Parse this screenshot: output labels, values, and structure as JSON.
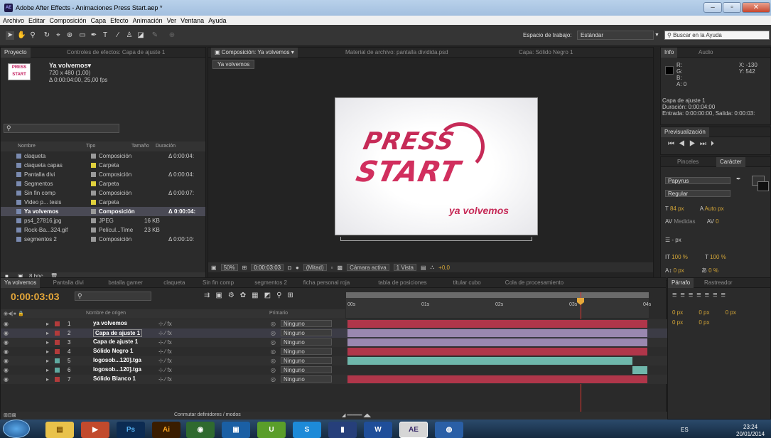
{
  "window": {
    "title": "Adobe After Effects - Animaciones Press Start.aep *",
    "app_badge": "AE"
  },
  "menu": [
    "Archivo",
    "Editar",
    "Composición",
    "Capa",
    "Efecto",
    "Animación",
    "Ver",
    "Ventana",
    "Ayuda"
  ],
  "toolbar": {
    "workspace_label": "Espacio de trabajo:",
    "workspace_value": "Estándar",
    "help_placeholder": "Buscar en la Ayuda"
  },
  "project": {
    "tab1": "Proyecto",
    "tab2": "Controles de efectos: Capa de ajuste 1",
    "selected_name": "Ya volvemos▾",
    "selected_size": "720 x 480 (1,00)",
    "selected_dur": "Δ 0:00:04:00, 25,00 fps",
    "columns": [
      "Nombre",
      "Tipo",
      "Tamaño",
      "Duración"
    ],
    "items": [
      {
        "name": "claqueta",
        "type": "Composición",
        "size": "",
        "dur": "Δ 0:00:04:",
        "color": "#9a9a9a"
      },
      {
        "name": "claqueta capas",
        "type": "Carpeta",
        "size": "",
        "dur": "",
        "color": "#e0d03c"
      },
      {
        "name": "Pantalla divi",
        "type": "Composición",
        "size": "",
        "dur": "Δ 0:00:04:",
        "color": "#9a9a9a"
      },
      {
        "name": "Segmentos",
        "type": "Carpeta",
        "size": "",
        "dur": "",
        "color": "#e0d03c"
      },
      {
        "name": "Sin fin comp",
        "type": "Composición",
        "size": "",
        "dur": "Δ 0:00:07:",
        "color": "#9a9a9a"
      },
      {
        "name": "Video p... tesis",
        "type": "Carpeta",
        "size": "",
        "dur": "",
        "color": "#e0d03c"
      },
      {
        "name": "Ya volvemos",
        "type": "Composición",
        "size": "",
        "dur": "Δ 0:00:04:",
        "color": "#9a9a9a"
      },
      {
        "name": "ps4_27816.jpg",
        "type": "JPEG",
        "size": "16 KB",
        "dur": "",
        "color": "#9a9a9a"
      },
      {
        "name": "Rock-Ba...324.gif",
        "type": "Películ...Time",
        "size": "23 KB",
        "dur": "",
        "color": "#9a9a9a"
      },
      {
        "name": "segmentos 2",
        "type": "Composición",
        "size": "",
        "dur": "Δ 0:00:10:",
        "color": "#9a9a9a"
      }
    ],
    "bpc": "8 bpc"
  },
  "comp": {
    "tab": "Composición: Ya volvemos",
    "tab2": "Material de archivo: pantalla dividida.psd",
    "tab3": "Capa: Sólido Negro 1",
    "breadcrumb": "Ya volvemos",
    "logo_line1": "PRESS",
    "logo_line2": "START",
    "logo_tag": "ya volvemos",
    "zoom": "50%",
    "timecode": "0:00:03:03",
    "resolution": "(Mitad)",
    "camera": "Cámara activa",
    "views": "1 Vista",
    "exposure": "+0,0"
  },
  "info": {
    "tab1": "Info",
    "tab2": "Audio",
    "r": "R:",
    "g": "G:",
    "b": "B:",
    "a": "A:  0",
    "x": "X: -130",
    "y": "Y:  542",
    "layer": "Capa de ajuste 1",
    "duration": "Duración: 0:00:04:00",
    "entrada": "Entrada: 0:00:00:00, Salida: 0:00:03:"
  },
  "preview": {
    "tab": "Previsualización"
  },
  "character": {
    "tab1": "Pinceles",
    "tab2": "Carácter",
    "font": "Papyrus",
    "style": "Regular",
    "size": "84 px",
    "leading": "Auto px",
    "kerning": "Medidas",
    "tracking": "0",
    "indent": "- px",
    "vscale": "100 %",
    "hscale": "100 %",
    "baseline": "0 px",
    "tsume": "0 %"
  },
  "paragraph": {
    "tab1": "Párrafo",
    "tab2": "Rastreador",
    "v1": "0 px",
    "v2": "0 px",
    "v3": "0 px",
    "v4": "0 px",
    "v5": "0 px"
  },
  "timeline": {
    "tabs": [
      "Ya volvemos",
      "Pantalla divi",
      "batalla gamer",
      "claqueta",
      "Sin fin comp",
      "segmentos 2",
      "ficha personal roja",
      "tabla de posiciones",
      "titular cubo",
      "Cola de procesamiento"
    ],
    "timecode": "0:00:03:03",
    "col_source": "Nombre de origen",
    "col_parent": "Primario",
    "ruler": [
      "00s",
      "01s",
      "02s",
      "03s",
      "04s"
    ],
    "layers": [
      {
        "num": "1",
        "name": "ya volvemos",
        "label": "#b23b3b",
        "parent": "Ninguno",
        "bar": "#b0364a",
        "start": 0,
        "end": 1
      },
      {
        "num": "2",
        "name": "Capa de ajuste 1",
        "label": "#b23b3b",
        "parent": "Ninguno",
        "bar": "#9a88b0",
        "start": 0,
        "end": 1
      },
      {
        "num": "3",
        "name": "Capa de ajuste 1",
        "label": "#b23b3b",
        "parent": "Ninguno",
        "bar": "#9a88b0",
        "start": 0,
        "end": 1
      },
      {
        "num": "4",
        "name": "Sólido Negro 1",
        "label": "#b23b3b",
        "parent": "Ninguno",
        "bar": "#b0364a",
        "start": 0,
        "end": 1
      },
      {
        "num": "5",
        "name": "logosob...120].tga",
        "label": "#5fa9a0",
        "parent": "Ninguno",
        "bar": "#6fb7ab",
        "start": 0,
        "end": 0.95
      },
      {
        "num": "6",
        "name": "logosob...120].tga",
        "label": "#5fa9a0",
        "parent": "Ninguno",
        "bar": "#6fb7ab",
        "start": 0.95,
        "end": 1
      },
      {
        "num": "7",
        "name": "Sólido Blanco 1",
        "label": "#b23b3b",
        "parent": "Ninguno",
        "bar": "#b0364a",
        "start": 0,
        "end": 1
      }
    ],
    "toggle_label": "Conmutar definidores / modos"
  },
  "taskbar": {
    "lang": "ES",
    "time": "23:24",
    "date": "20/01/2014"
  }
}
